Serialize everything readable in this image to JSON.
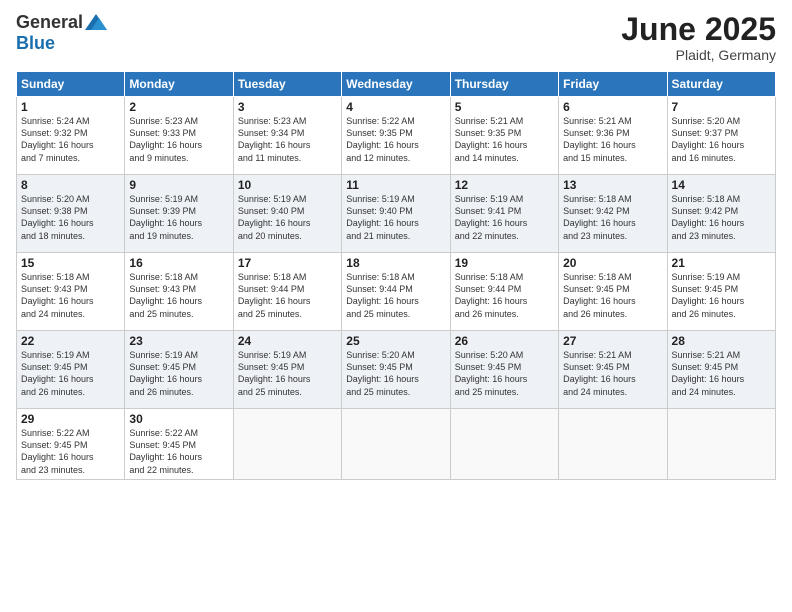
{
  "header": {
    "logo_general": "General",
    "logo_blue": "Blue",
    "month_title": "June 2025",
    "location": "Plaidt, Germany"
  },
  "weekdays": [
    "Sunday",
    "Monday",
    "Tuesday",
    "Wednesday",
    "Thursday",
    "Friday",
    "Saturday"
  ],
  "weeks": [
    [
      {
        "day": "1",
        "sunrise": "5:24 AM",
        "sunset": "9:32 PM",
        "daylight": "16 hours and 7 minutes."
      },
      {
        "day": "2",
        "sunrise": "5:23 AM",
        "sunset": "9:33 PM",
        "daylight": "16 hours and 9 minutes."
      },
      {
        "day": "3",
        "sunrise": "5:23 AM",
        "sunset": "9:34 PM",
        "daylight": "16 hours and 11 minutes."
      },
      {
        "day": "4",
        "sunrise": "5:22 AM",
        "sunset": "9:35 PM",
        "daylight": "16 hours and 12 minutes."
      },
      {
        "day": "5",
        "sunrise": "5:21 AM",
        "sunset": "9:35 PM",
        "daylight": "16 hours and 14 minutes."
      },
      {
        "day": "6",
        "sunrise": "5:21 AM",
        "sunset": "9:36 PM",
        "daylight": "16 hours and 15 minutes."
      },
      {
        "day": "7",
        "sunrise": "5:20 AM",
        "sunset": "9:37 PM",
        "daylight": "16 hours and 16 minutes."
      }
    ],
    [
      {
        "day": "8",
        "sunrise": "5:20 AM",
        "sunset": "9:38 PM",
        "daylight": "16 hours and 18 minutes."
      },
      {
        "day": "9",
        "sunrise": "5:19 AM",
        "sunset": "9:39 PM",
        "daylight": "16 hours and 19 minutes."
      },
      {
        "day": "10",
        "sunrise": "5:19 AM",
        "sunset": "9:40 PM",
        "daylight": "16 hours and 20 minutes."
      },
      {
        "day": "11",
        "sunrise": "5:19 AM",
        "sunset": "9:40 PM",
        "daylight": "16 hours and 21 minutes."
      },
      {
        "day": "12",
        "sunrise": "5:19 AM",
        "sunset": "9:41 PM",
        "daylight": "16 hours and 22 minutes."
      },
      {
        "day": "13",
        "sunrise": "5:18 AM",
        "sunset": "9:42 PM",
        "daylight": "16 hours and 23 minutes."
      },
      {
        "day": "14",
        "sunrise": "5:18 AM",
        "sunset": "9:42 PM",
        "daylight": "16 hours and 23 minutes."
      }
    ],
    [
      {
        "day": "15",
        "sunrise": "5:18 AM",
        "sunset": "9:43 PM",
        "daylight": "16 hours and 24 minutes."
      },
      {
        "day": "16",
        "sunrise": "5:18 AM",
        "sunset": "9:43 PM",
        "daylight": "16 hours and 25 minutes."
      },
      {
        "day": "17",
        "sunrise": "5:18 AM",
        "sunset": "9:44 PM",
        "daylight": "16 hours and 25 minutes."
      },
      {
        "day": "18",
        "sunrise": "5:18 AM",
        "sunset": "9:44 PM",
        "daylight": "16 hours and 25 minutes."
      },
      {
        "day": "19",
        "sunrise": "5:18 AM",
        "sunset": "9:44 PM",
        "daylight": "16 hours and 26 minutes."
      },
      {
        "day": "20",
        "sunrise": "5:18 AM",
        "sunset": "9:45 PM",
        "daylight": "16 hours and 26 minutes."
      },
      {
        "day": "21",
        "sunrise": "5:19 AM",
        "sunset": "9:45 PM",
        "daylight": "16 hours and 26 minutes."
      }
    ],
    [
      {
        "day": "22",
        "sunrise": "5:19 AM",
        "sunset": "9:45 PM",
        "daylight": "16 hours and 26 minutes."
      },
      {
        "day": "23",
        "sunrise": "5:19 AM",
        "sunset": "9:45 PM",
        "daylight": "16 hours and 26 minutes."
      },
      {
        "day": "24",
        "sunrise": "5:19 AM",
        "sunset": "9:45 PM",
        "daylight": "16 hours and 25 minutes."
      },
      {
        "day": "25",
        "sunrise": "5:20 AM",
        "sunset": "9:45 PM",
        "daylight": "16 hours and 25 minutes."
      },
      {
        "day": "26",
        "sunrise": "5:20 AM",
        "sunset": "9:45 PM",
        "daylight": "16 hours and 25 minutes."
      },
      {
        "day": "27",
        "sunrise": "5:21 AM",
        "sunset": "9:45 PM",
        "daylight": "16 hours and 24 minutes."
      },
      {
        "day": "28",
        "sunrise": "5:21 AM",
        "sunset": "9:45 PM",
        "daylight": "16 hours and 24 minutes."
      }
    ],
    [
      {
        "day": "29",
        "sunrise": "5:22 AM",
        "sunset": "9:45 PM",
        "daylight": "16 hours and 23 minutes."
      },
      {
        "day": "30",
        "sunrise": "5:22 AM",
        "sunset": "9:45 PM",
        "daylight": "16 hours and 22 minutes."
      },
      null,
      null,
      null,
      null,
      null
    ]
  ],
  "labels": {
    "sunrise": "Sunrise:",
    "sunset": "Sunset:",
    "daylight": "Daylight:"
  }
}
